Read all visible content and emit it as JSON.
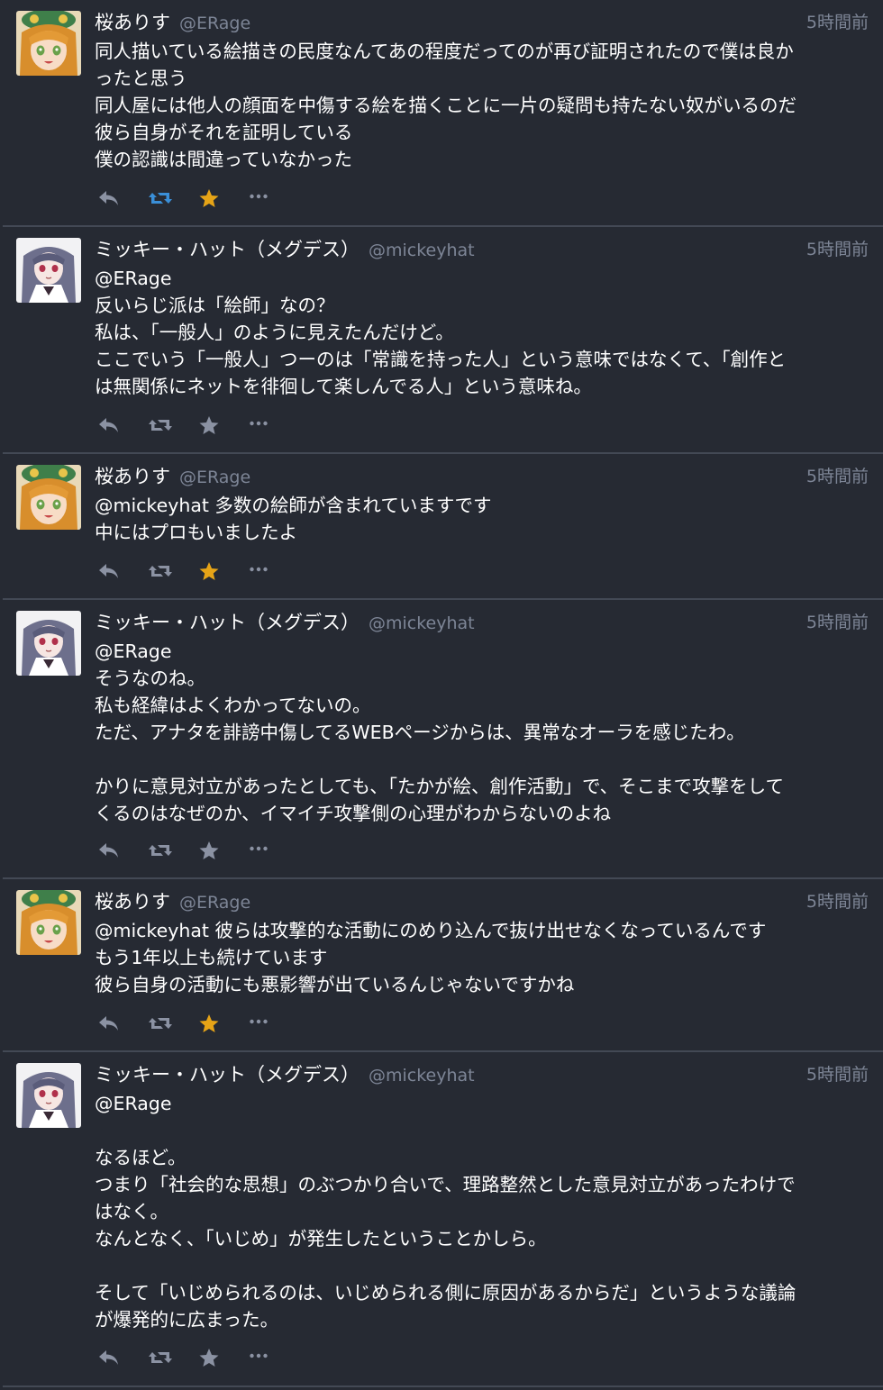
{
  "colors": {
    "background": "#262a33",
    "divider": "#434955",
    "muted": "#7d8596",
    "retweet_active": "#3a8fd8",
    "favorite_active": "#e6a417",
    "icon_default": "#8b92a3"
  },
  "tweets": [
    {
      "display_name": "桜ありす",
      "screen_name": "@ERage",
      "time": "5時間前",
      "avatar": "sakura-avatar",
      "lines": [
        "同人描いている絵描きの民度なんてあの程度だってのが再び証明されたので僕は良か",
        "ったと思う",
        "同人屋には他人の顔面を中傷する絵を描くことに一片の疑問も持たない奴がいるのだ",
        "彼ら自身がそれを証明している",
        "僕の認識は間違っていなかった"
      ],
      "retweeted": true,
      "favorited": true
    },
    {
      "display_name": "ミッキー・ハット（メグデス）",
      "screen_name": "@mickeyhat",
      "time": "5時間前",
      "avatar": "mickey-avatar",
      "lines": [
        "@ERage",
        "反いらじ派は「絵師」なの？",
        "私は、「一般人」のように見えたんだけど。",
        "ここでいう「一般人」つーのは「常識を持った人」という意味ではなくて、「創作と",
        "は無関係にネットを徘徊して楽しんでる人」という意味ね。"
      ],
      "retweeted": false,
      "favorited": false
    },
    {
      "display_name": "桜ありす",
      "screen_name": "@ERage",
      "time": "5時間前",
      "avatar": "sakura-avatar",
      "lines": [
        "@mickeyhat 多数の絵師が含まれていますです",
        "中にはプロもいましたよ"
      ],
      "retweeted": false,
      "favorited": true
    },
    {
      "display_name": "ミッキー・ハット（メグデス）",
      "screen_name": "@mickeyhat",
      "time": "5時間前",
      "avatar": "mickey-avatar",
      "lines": [
        "@ERage",
        "そうなのね。",
        "私も経緯はよくわかってないの。",
        "ただ、アナタを誹謗中傷してるWEBページからは、異常なオーラを感じたわ。",
        "",
        "かりに意見対立があったとしても、「たかが絵、創作活動」で、そこまで攻撃をして",
        "くるのはなぜのか、イマイチ攻撃側の心理がわからないのよね"
      ],
      "retweeted": false,
      "favorited": false
    },
    {
      "display_name": "桜ありす",
      "screen_name": "@ERage",
      "time": "5時間前",
      "avatar": "sakura-avatar",
      "lines": [
        "@mickeyhat 彼らは攻撃的な活動にのめり込んで抜け出せなくなっているんです",
        "もう1年以上も続けています",
        "彼ら自身の活動にも悪影響が出ているんじゃないですかね"
      ],
      "retweeted": false,
      "favorited": true
    },
    {
      "display_name": "ミッキー・ハット（メグデス）",
      "screen_name": "@mickeyhat",
      "time": "5時間前",
      "avatar": "mickey-avatar",
      "lines": [
        "@ERage",
        "",
        "なるほど。",
        "つまり「社会的な思想」のぶつかり合いで、理路整然とした意見対立があったわけで",
        "はなく。",
        "なんとなく、「いじめ」が発生したということかしら。",
        "",
        "そして「いじめられるのは、いじめられる側に原因があるからだ」というような議論",
        "が爆発的に広まった。"
      ],
      "retweeted": false,
      "favorited": false
    }
  ]
}
